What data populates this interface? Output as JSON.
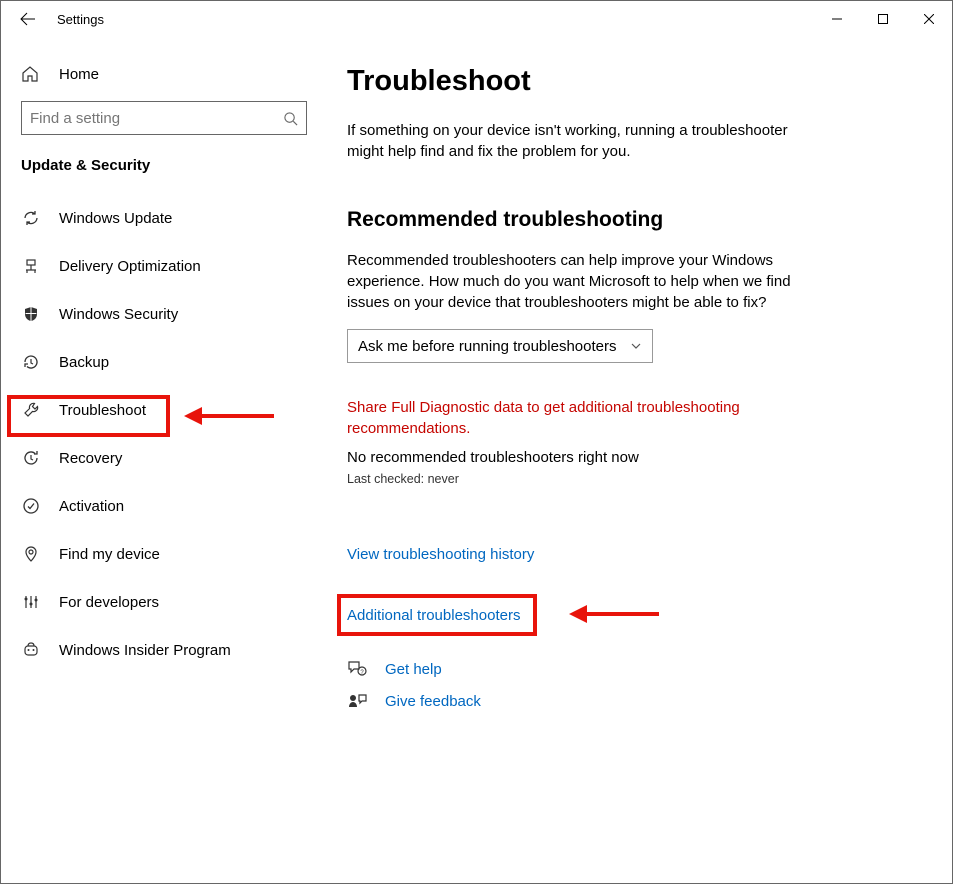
{
  "window": {
    "title": "Settings"
  },
  "sidebar": {
    "home": "Home",
    "search_placeholder": "Find a setting",
    "section": "Update & Security",
    "items": [
      {
        "label": "Windows Update"
      },
      {
        "label": "Delivery Optimization"
      },
      {
        "label": "Windows Security"
      },
      {
        "label": "Backup"
      },
      {
        "label": "Troubleshoot"
      },
      {
        "label": "Recovery"
      },
      {
        "label": "Activation"
      },
      {
        "label": "Find my device"
      },
      {
        "label": "For developers"
      },
      {
        "label": "Windows Insider Program"
      }
    ]
  },
  "main": {
    "title": "Troubleshoot",
    "lead": "If something on your device isn't working, running a troubleshooter might help find and fix the problem for you.",
    "recommended_title": "Recommended troubleshooting",
    "recommended_text": "Recommended troubleshooters can help improve your Windows experience. How much do you want Microsoft to help when we find issues on your device that troubleshooters might be able to fix?",
    "dropdown_value": "Ask me before running troubleshooters",
    "warning": "Share Full Diagnostic data to get additional troubleshooting recommendations.",
    "no_recs": "No recommended troubleshooters right now",
    "last_checked": "Last checked: never",
    "history_link": "View troubleshooting history",
    "additional_link": "Additional troubleshooters",
    "get_help": "Get help",
    "give_feedback": "Give feedback"
  }
}
